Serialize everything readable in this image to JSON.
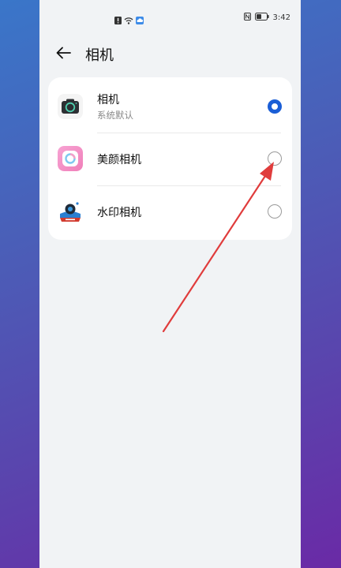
{
  "status_bar": {
    "time": "3:42"
  },
  "header": {
    "title": "相机"
  },
  "apps": [
    {
      "name": "相机",
      "subtitle": "系统默认",
      "selected": true,
      "icon": "camera-app-icon"
    },
    {
      "name": "美颜相机",
      "subtitle": "",
      "selected": false,
      "icon": "beauty-camera-app-icon"
    },
    {
      "name": "水印相机",
      "subtitle": "",
      "selected": false,
      "icon": "watermark-camera-app-icon"
    }
  ],
  "colors": {
    "accent": "#1a5ed6",
    "annotation_arrow": "#e03c3c"
  }
}
